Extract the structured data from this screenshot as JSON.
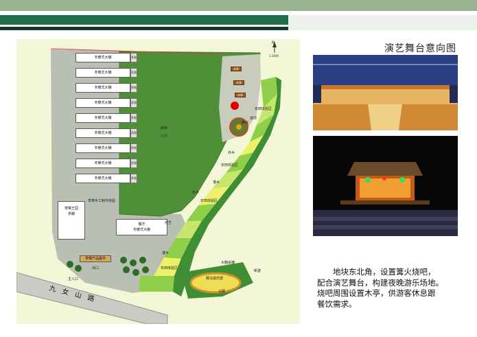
{
  "header": {
    "title": "演艺舞台意向图"
  },
  "description": {
    "lines": [
      "地块东北角，设置篝火烧吧，",
      "配合演艺舞台，构建夜晚游乐场地。",
      "烧吧周围设置木亭，供游客休息跟",
      "餐饮需求。"
    ]
  },
  "plan": {
    "halls": [
      "冬暖式大棚",
      "冬暖式大棚",
      "冬暖式大棚",
      "冬暖式大棚",
      "冬暖式大棚",
      "冬暖式大棚",
      "冬暖式大棚",
      "冬暖式大棚",
      "冬暖式大棚"
    ],
    "hall_ends": [
      "养殖",
      "养殖",
      "养殖",
      "养殖",
      "养殖",
      "养殖",
      "养殖",
      "养殖",
      "养殖"
    ],
    "caomei_park": "草莓王园\n烘棚",
    "workshop": "草莓手工制作体验",
    "restaurant": "餐厅\n冬暖式大棚",
    "product_store": "草莓产品超市",
    "main_entrance": "主入口",
    "exit": "出口",
    "road": "九 女 山 路",
    "forest": "树林",
    "forest_sub": "红果",
    "huts": [
      "木亭",
      "木亭",
      "木亭"
    ],
    "zones": {
      "farm1": "农田体验区",
      "farm2": "农田体验区",
      "farm3": "农田体验区",
      "farm4": "农田体验区",
      "qiao": "乔木",
      "qiao2": "乔木",
      "guanmu": "灌木",
      "guanmu2": "灌木",
      "caodi": "草坪",
      "jiyi": "技艺",
      "horse": "赛马俱乐部",
      "horse2": "马厩",
      "stage": "舞台",
      "daiyu": "大棚采摘",
      "xin": "新建"
    },
    "north": "N",
    "scale": "1:1000"
  },
  "colors": {
    "accent_dark": "#1f6e49",
    "accent_light": "#9bb594",
    "grass": "#4f8f38",
    "path": "#b8bdb0",
    "bonfire": "#e00000"
  }
}
